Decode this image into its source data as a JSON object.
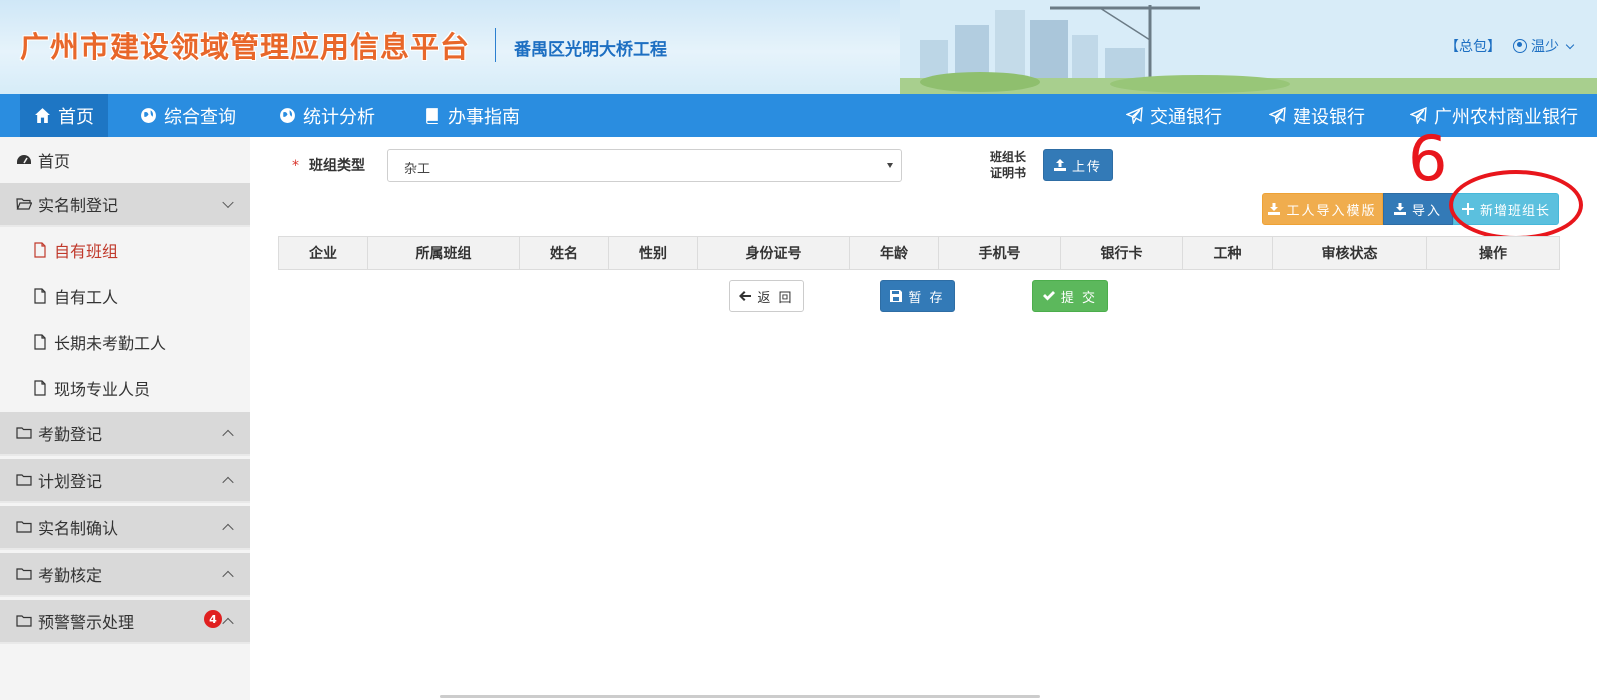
{
  "header": {
    "brand_title": "广州市建设领域管理应用信息平台",
    "project_name": "番禺区光明大桥工程",
    "role_label": "【总包】",
    "user_name": "温少"
  },
  "nav": {
    "items": [
      {
        "label": "首页",
        "icon": "home-icon",
        "active": true
      },
      {
        "label": "综合查询",
        "icon": "globe-icon"
      },
      {
        "label": "统计分析",
        "icon": "globe-icon"
      },
      {
        "label": "办事指南",
        "icon": "book-icon"
      }
    ],
    "banks": [
      {
        "label": "交通银行",
        "icon": "send-icon"
      },
      {
        "label": "建设银行",
        "icon": "send-icon"
      },
      {
        "label": "广州农村商业银行",
        "icon": "send-icon"
      }
    ]
  },
  "sidebar": {
    "home": "首页",
    "groups": [
      {
        "label": "实名制登记",
        "expanded": true,
        "children": [
          "自有班组",
          "自有工人",
          "长期未考勤工人",
          "现场专业人员"
        ],
        "active_child": "自有班组"
      },
      {
        "label": "考勤登记"
      },
      {
        "label": "计划登记"
      },
      {
        "label": "实名制确认"
      },
      {
        "label": "考勤核定"
      },
      {
        "label": "预警警示处理",
        "badge": "4"
      }
    ]
  },
  "form": {
    "required_mark": "*",
    "team_type_label": "班组类型",
    "team_type_value": "杂工",
    "cert_label_line1": "班组长",
    "cert_label_line2": "证明书",
    "upload_button": "上传",
    "template_button": "工人导入模版",
    "import_button": "导入",
    "add_leader_button": "新增班组长"
  },
  "table": {
    "columns": [
      "企业",
      "所属班组",
      "姓名",
      "性别",
      "身份证号",
      "年龄",
      "手机号",
      "银行卡",
      "工种",
      "审核状态",
      "操作"
    ]
  },
  "actions": {
    "back": "返 回",
    "save": "暂 存",
    "submit": "提 交"
  },
  "annotation": {
    "step_number": "6",
    "color": "#e8161c"
  },
  "colors": {
    "nav_bg": "#2a8de0",
    "brand_orange": "#e8672a",
    "primary": "#337ab7",
    "warning": "#f0ad4e",
    "info": "#5bc0de",
    "success": "#5cb85c"
  }
}
